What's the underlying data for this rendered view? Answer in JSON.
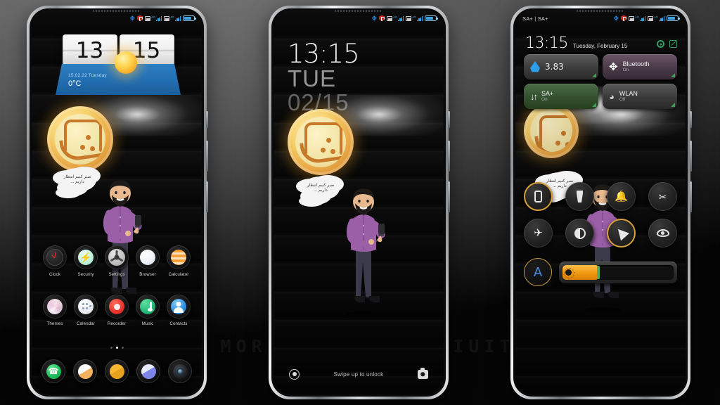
{
  "watermark": "VISIT FOR MORE THEMES - MIUITHEMER.COM",
  "statusbar": {
    "dual_sim_label": "SA+ | SA+",
    "icons": [
      "bluetooth-icon",
      "shield-icon",
      "sim1-4g-signal-icon",
      "sim2-4g-signal-icon",
      "battery-icon"
    ],
    "network_label": "4G"
  },
  "phone1": {
    "name": "home-screen",
    "widget": {
      "hour": "13",
      "minute": "15",
      "date": "15.02.22 Tuesday",
      "temperature": "0°C",
      "weather_icon": "sun-icon"
    },
    "bubble_text": "صبر کنیم انتظار داریم ...",
    "apps_row1": [
      {
        "label": "Clock",
        "icon": "clock-icon"
      },
      {
        "label": "Security",
        "icon": "shield-bolt-icon"
      },
      {
        "label": "Settings",
        "icon": "gear-icon"
      },
      {
        "label": "Browser",
        "icon": "browser-icon"
      },
      {
        "label": "Calculator",
        "icon": "calculator-icon"
      }
    ],
    "apps_row2": [
      {
        "label": "Themes",
        "icon": "themes-icon"
      },
      {
        "label": "Calendar",
        "icon": "calendar-icon"
      },
      {
        "label": "Recorder",
        "icon": "recorder-icon"
      },
      {
        "label": "Music",
        "icon": "music-note-icon"
      },
      {
        "label": "Contacts",
        "icon": "contacts-icon"
      }
    ],
    "dock": [
      {
        "name": "phone-icon"
      },
      {
        "name": "messages-icon"
      },
      {
        "name": "gallery-icon"
      },
      {
        "name": "mi-browser-icon"
      },
      {
        "name": "camera-icon"
      }
    ],
    "page_dots": {
      "count": 3,
      "active_index": 1
    }
  },
  "phone2": {
    "name": "lock-screen",
    "time": "13:15",
    "weekday": "TUE",
    "date": "02/15",
    "unlock_hint": "Swipe up to unlock",
    "left_icon": "ring-button-icon",
    "right_icon": "camera-icon"
  },
  "phone3": {
    "name": "control-center",
    "time": "13:15",
    "date": "Tuesday, February 15",
    "gear_icon": "gear-icon",
    "edit_icon": "edit-icon",
    "tiles": [
      {
        "title": "3.83",
        "subtitle": "",
        "icon": "mobile-data-drop-icon",
        "state": "on",
        "style": "data"
      },
      {
        "title": "Bluetooth",
        "subtitle": "On",
        "icon": "bluetooth-icon",
        "state": "on",
        "style": "bt"
      },
      {
        "title": "SA+",
        "subtitle": "On",
        "icon": "data-arrows-icon",
        "state": "on",
        "style": "sa"
      },
      {
        "title": "WLAN",
        "subtitle": "Off",
        "icon": "wifi-icon",
        "state": "off",
        "style": "wlan"
      }
    ],
    "toggles_row1": [
      {
        "name": "vibrate-icon",
        "active": true
      },
      {
        "name": "flashlight-icon",
        "active": false
      },
      {
        "name": "bell-icon",
        "active": false
      },
      {
        "name": "screenshot-scissors-icon",
        "active": false
      }
    ],
    "toggles_row2": [
      {
        "name": "airplane-mode-icon",
        "active": false
      },
      {
        "name": "dark-mode-contrast-icon",
        "active": false
      },
      {
        "name": "location-icon",
        "active": true
      },
      {
        "name": "eye-care-icon",
        "active": false
      }
    ],
    "brightness": {
      "auto_label": "A",
      "percent": 33,
      "icon": "brightness-sun-icon"
    }
  }
}
